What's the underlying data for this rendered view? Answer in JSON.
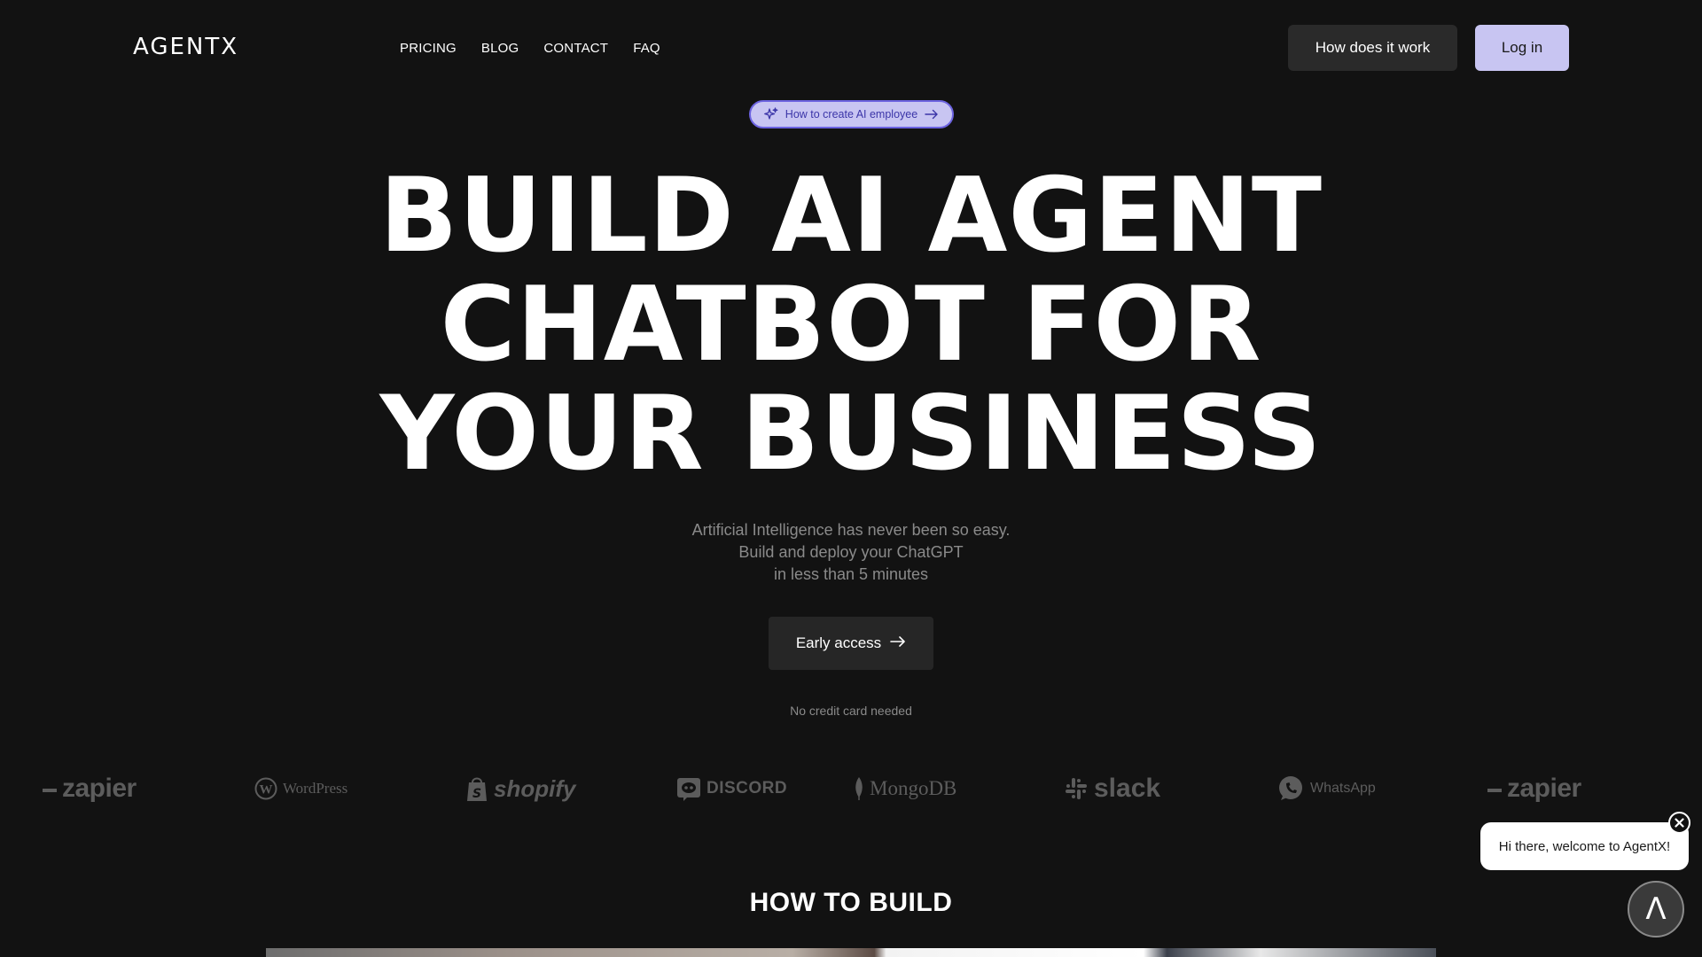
{
  "header": {
    "logo": "AGENTX",
    "nav": [
      "PRICING",
      "BLOG",
      "CONTACT",
      "FAQ"
    ],
    "how_label": "How does it work",
    "login_label": "Log in"
  },
  "pill": {
    "label": "How to create AI employee",
    "icon": "sparkles-icon"
  },
  "hero": {
    "line1": "BUILD AI AGENT",
    "line2": "CHATBOT FOR",
    "line3": "YOUR BUSINESS"
  },
  "sub": {
    "line1": "Artificial Intelligence has never been so easy.",
    "line2": "Build and deploy your ChatGPT",
    "line3": "in less than 5 minutes"
  },
  "cta": {
    "label": "Early access",
    "note": "No credit card needed"
  },
  "logos": [
    "zapier",
    "WordPress",
    "shopify",
    "DISCORD",
    "MongoDB",
    "slack",
    "WhatsApp",
    "zapier"
  ],
  "section": {
    "title": "HOW TO BUILD"
  },
  "chat": {
    "message": "Hi there, welcome to AgentX!",
    "launcher_glyph": "Λ"
  },
  "colors": {
    "background": "#121212",
    "login_bg": "#c8c5f2",
    "pill_border": "#6c63e0",
    "logo_gray": "#5c5c5c"
  }
}
